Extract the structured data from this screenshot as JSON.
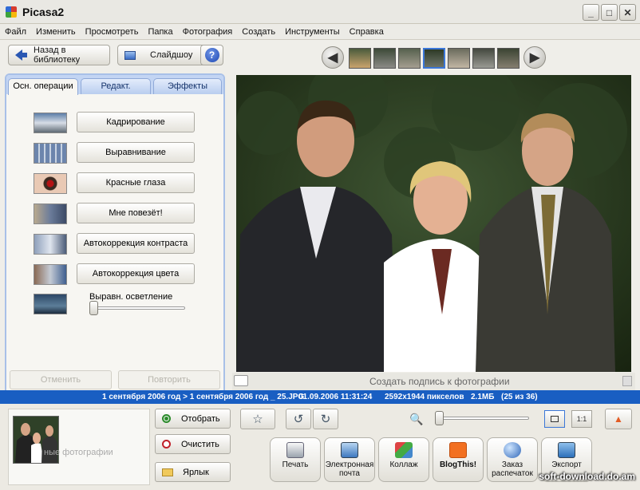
{
  "window": {
    "title": "Picasa2"
  },
  "menu": [
    "Файл",
    "Изменить",
    "Просмотреть",
    "Папка",
    "Фотография",
    "Создать",
    "Инструменты",
    "Справка"
  ],
  "toolbar": {
    "back_label": "Назад в библиотеку",
    "slideshow_label": "Слайдшоу",
    "help_label": "?"
  },
  "tabs": [
    "Осн. операции",
    "Редакт.",
    "Эффекты"
  ],
  "operations": [
    "Кадрирование",
    "Выравнивание",
    "Красные глаза",
    "Мне повезёт!",
    "Автокоррекция контраста",
    "Автокоррекция цвета"
  ],
  "fill_light": {
    "label": "Выравн. осветление",
    "value": 0
  },
  "undo_label": "Отменить",
  "redo_label": "Повторить",
  "caption": {
    "placeholder": "Создать подпись к фотографии"
  },
  "info": {
    "folder_date": "1 сентября 2006 год",
    "separator": " > ",
    "path": "1 сентября 2006 год _ 25.JPG",
    "datetime": "01.09.2006 11:31:24",
    "dimensions": "2592x1944 пикселов",
    "size": "2.1МБ",
    "position": "(25 из 36)"
  },
  "tray": {
    "text": "ные фотографии"
  },
  "tray_buttons": {
    "select": "Отобрать",
    "clear": "Очистить",
    "label": "Ярлык"
  },
  "actions": [
    {
      "icon": "printer-icon",
      "label": "Печать"
    },
    {
      "icon": "email-icon",
      "label": "Электронная почта"
    },
    {
      "icon": "collage-icon",
      "label": "Коллаж"
    },
    {
      "icon": "blogger-icon",
      "label": "BlogThis!"
    },
    {
      "icon": "globe-icon",
      "label": "Заказ распечаток"
    },
    {
      "icon": "export-icon",
      "label": "Экспорт"
    }
  ],
  "view_buttons": [
    "",
    "1:1"
  ],
  "watermark": "soft-download.do.am"
}
